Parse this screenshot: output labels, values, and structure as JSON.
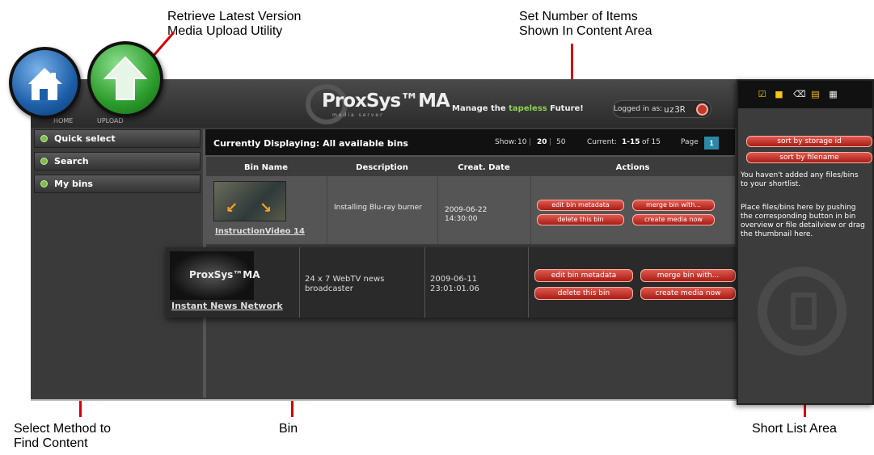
{
  "annotations": {
    "upload_line1": "Retrieve Latest Version",
    "upload_line2": "Media Upload Utility",
    "items_line1": "Set Number of Items",
    "items_line2": "Shown In Content Area",
    "select_line1": "Select Method to",
    "select_line2": "Find Content",
    "bin": "Bin",
    "shortlist": "Short List Area"
  },
  "nav": {
    "home": "HOME",
    "upload": "UPLOAD"
  },
  "header": {
    "logo": "ProxSys™MA",
    "logo_sub": "media server",
    "tagline_a": "Manage the",
    "tagline_b": "tapeless",
    "tagline_c": "Future!",
    "logged_in_label": "Logged in as:",
    "username": "uz3R"
  },
  "sidebar": {
    "items": [
      {
        "label": "Quick select"
      },
      {
        "label": "Search"
      },
      {
        "label": "My bins"
      }
    ]
  },
  "content": {
    "title": "Currently Displaying: All available bins",
    "show_label": "Show:",
    "show_options": [
      "10",
      "20",
      "50"
    ],
    "show_selected": "20",
    "current_label": "Current:",
    "current_range": "1-15",
    "current_of": "of 15",
    "page_label": "Page",
    "page_number": "1",
    "columns": [
      "Bin Name",
      "Description",
      "Creat. Date",
      "Actions"
    ],
    "rows": [
      {
        "name": "InstructionVideo 14",
        "description": "Installing Blu-ray burner",
        "date": "2009-06-22",
        "time": "14:30:00",
        "actions": [
          "edit bin metadata",
          "merge bin with...",
          "delete this bin",
          "create media now"
        ]
      },
      {
        "name": "Instant News Network",
        "thumb_text": "ProxSys™MA",
        "description_1": "24 x 7 WebTV news",
        "description_2": "broadcaster",
        "date": "2009-06-11",
        "time": "23:01:01.06",
        "actions": [
          "edit bin metadata",
          "merge bin with...",
          "delete this bin",
          "create media now"
        ]
      }
    ]
  },
  "shortlist": {
    "sort_storage": "sort by storage id",
    "sort_filename": "sort by filename",
    "empty_1": "You haven't added any files/bins",
    "empty_2": "to your shortlist.",
    "hint_1": "Place files/bins here by pushing",
    "hint_2": "the corresponding button in bin",
    "hint_3": "overview or file detailview or drag",
    "hint_4": "the thumbnail here.",
    "icons": [
      "checkbox-icon",
      "select-icon",
      "trash-icon",
      "print-icon",
      "pdf-icon"
    ]
  },
  "colors": {
    "accent_red": "#c0392b",
    "accent_green": "#8fd14f",
    "marker_red": "#d40000",
    "page_blue": "#2b89a8"
  }
}
